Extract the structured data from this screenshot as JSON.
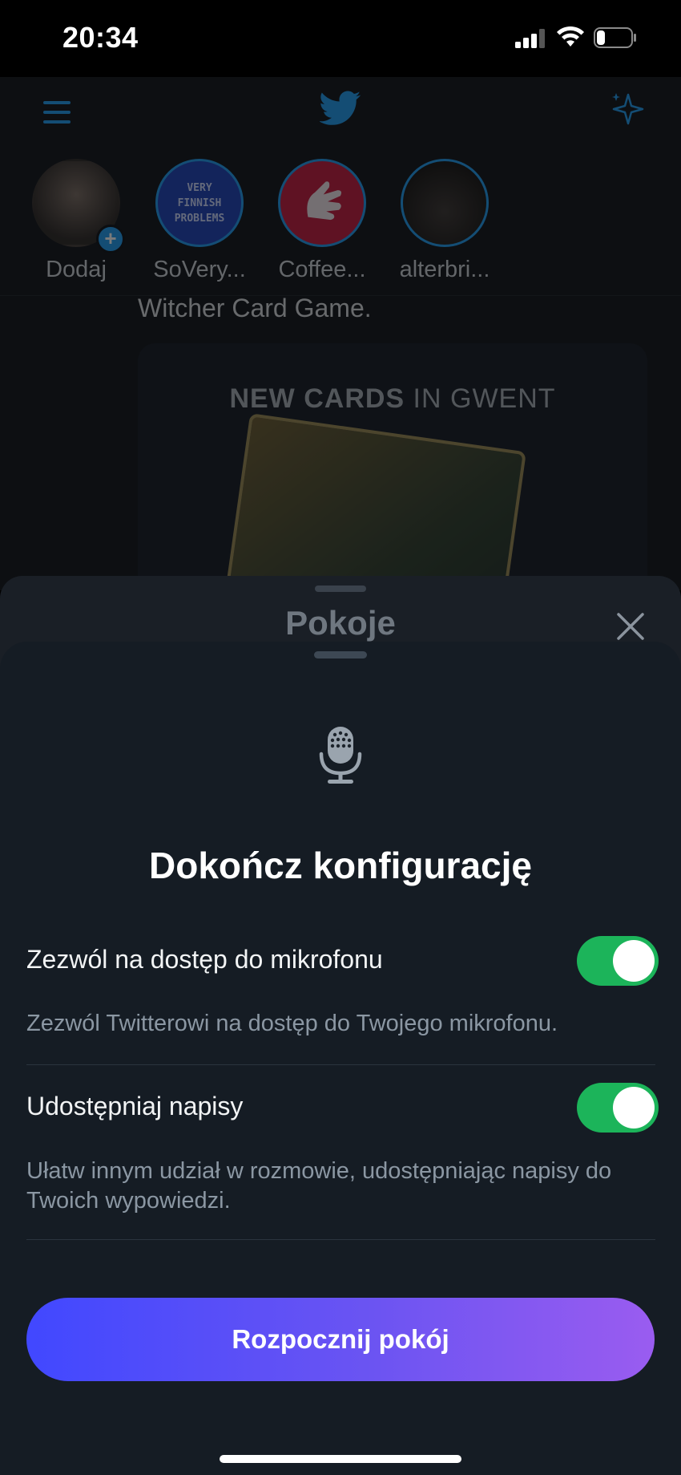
{
  "status_bar": {
    "time": "20:34",
    "battery_level": 0.25
  },
  "timeline": {
    "fleets": [
      {
        "label": "Dodaj"
      },
      {
        "label": "SoVery...",
        "badge_text": "VERY FINNISH PROBLEMS"
      },
      {
        "label": "Coffee..."
      },
      {
        "label": "alterbri..."
      }
    ],
    "tweet_text": "Witcher Card Game.",
    "media_title_bold": "NEW CARDS",
    "media_title_rest": " IN GWENT"
  },
  "rooms_sheet": {
    "title": "Pokoje"
  },
  "setup_sheet": {
    "title": "Dokończ konfigurację",
    "options": [
      {
        "label": "Zezwól na dostęp do mikrofonu",
        "description": "Zezwól Twitterowi na dostęp do Twojego mikrofonu.",
        "enabled": true
      },
      {
        "label": "Udostępniaj napisy",
        "description": "Ułatw innym udział w rozmowie, udostępniając napisy do Twoich wypowiedzi.",
        "enabled": true
      }
    ],
    "start_button": "Rozpocznij pokój"
  },
  "colors": {
    "toggle_on": "#1cb45a",
    "button_gradient_start": "#4148ff",
    "button_gradient_end": "#9a5cf0",
    "twitter_blue": "#1d9bf0"
  },
  "icons": [
    "menu-icon",
    "twitter-bird-icon",
    "sparkle-icon",
    "close-icon",
    "microphone-icon"
  ]
}
